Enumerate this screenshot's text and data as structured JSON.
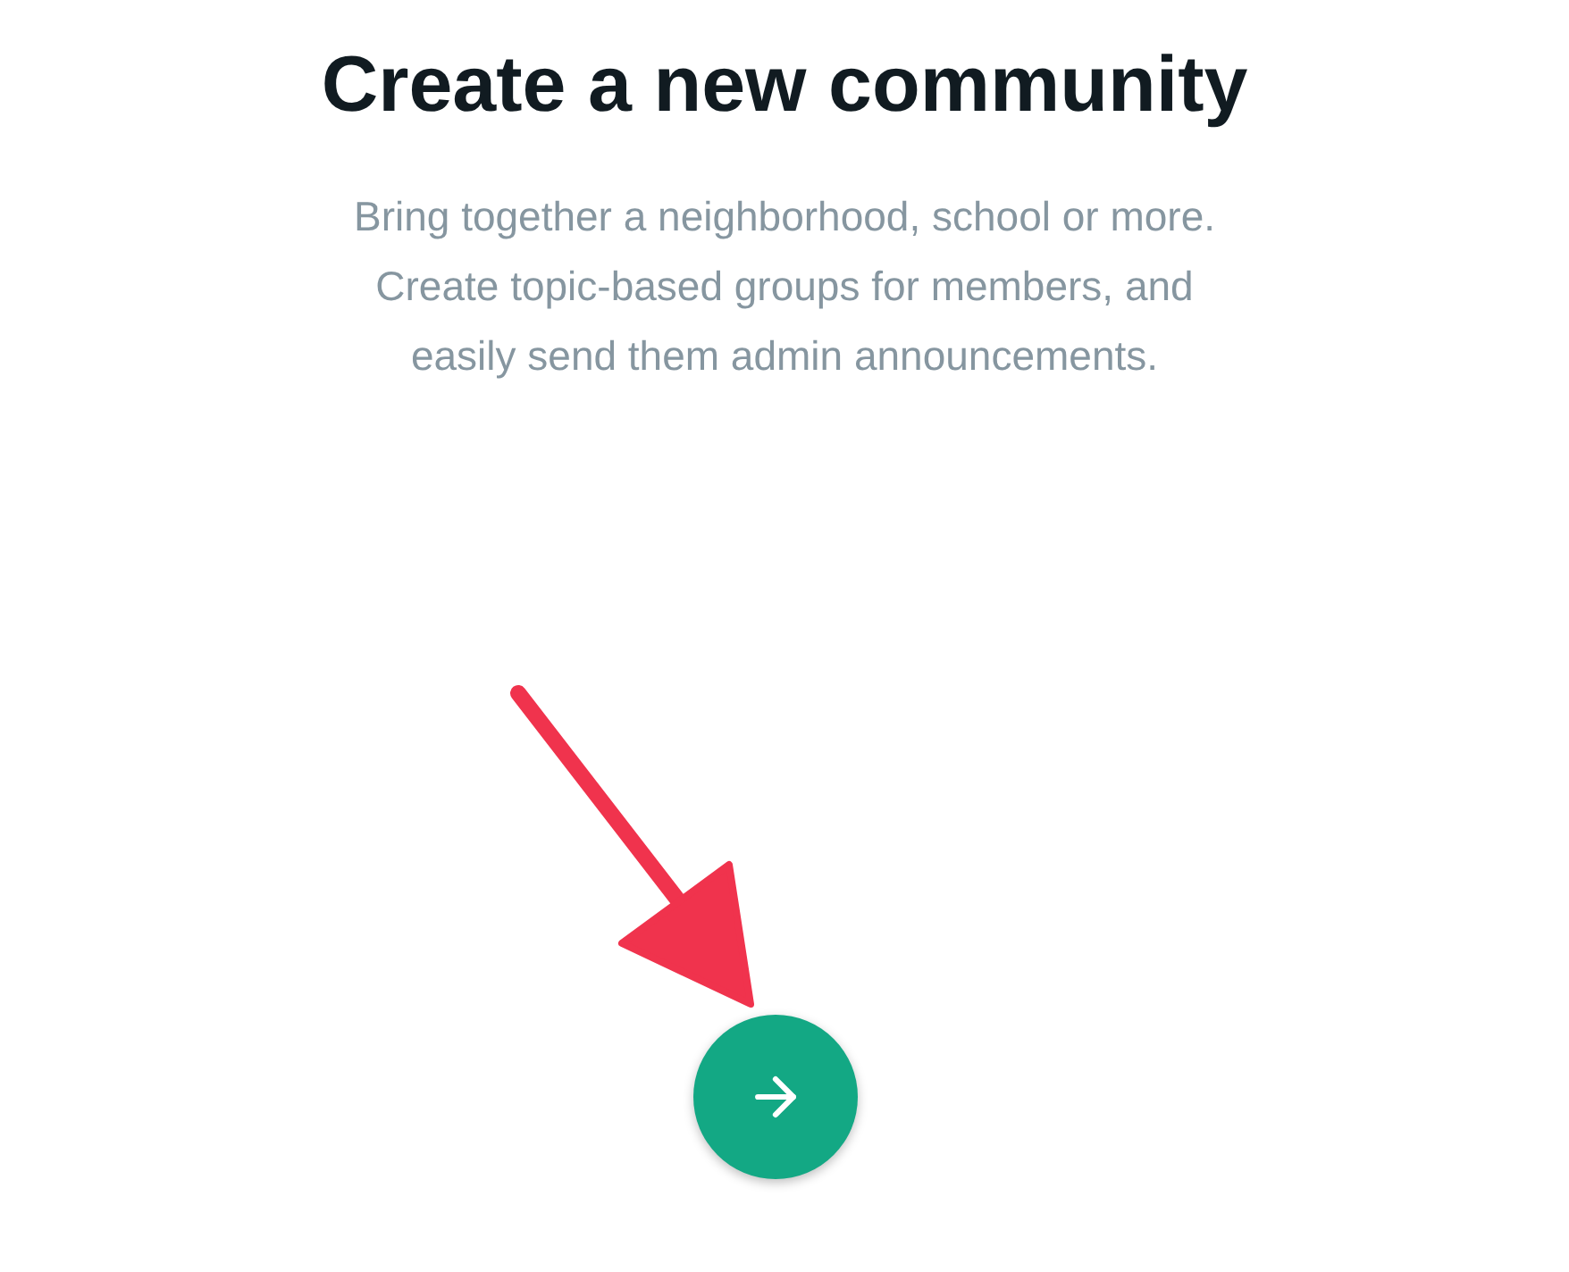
{
  "title": "Create a new community",
  "description_lines": [
    "Bring together a neighborhood, school or more.",
    "Create topic-based groups for members, and",
    "easily send them admin announcements."
  ],
  "next_button": {
    "kind": "arrow"
  }
}
